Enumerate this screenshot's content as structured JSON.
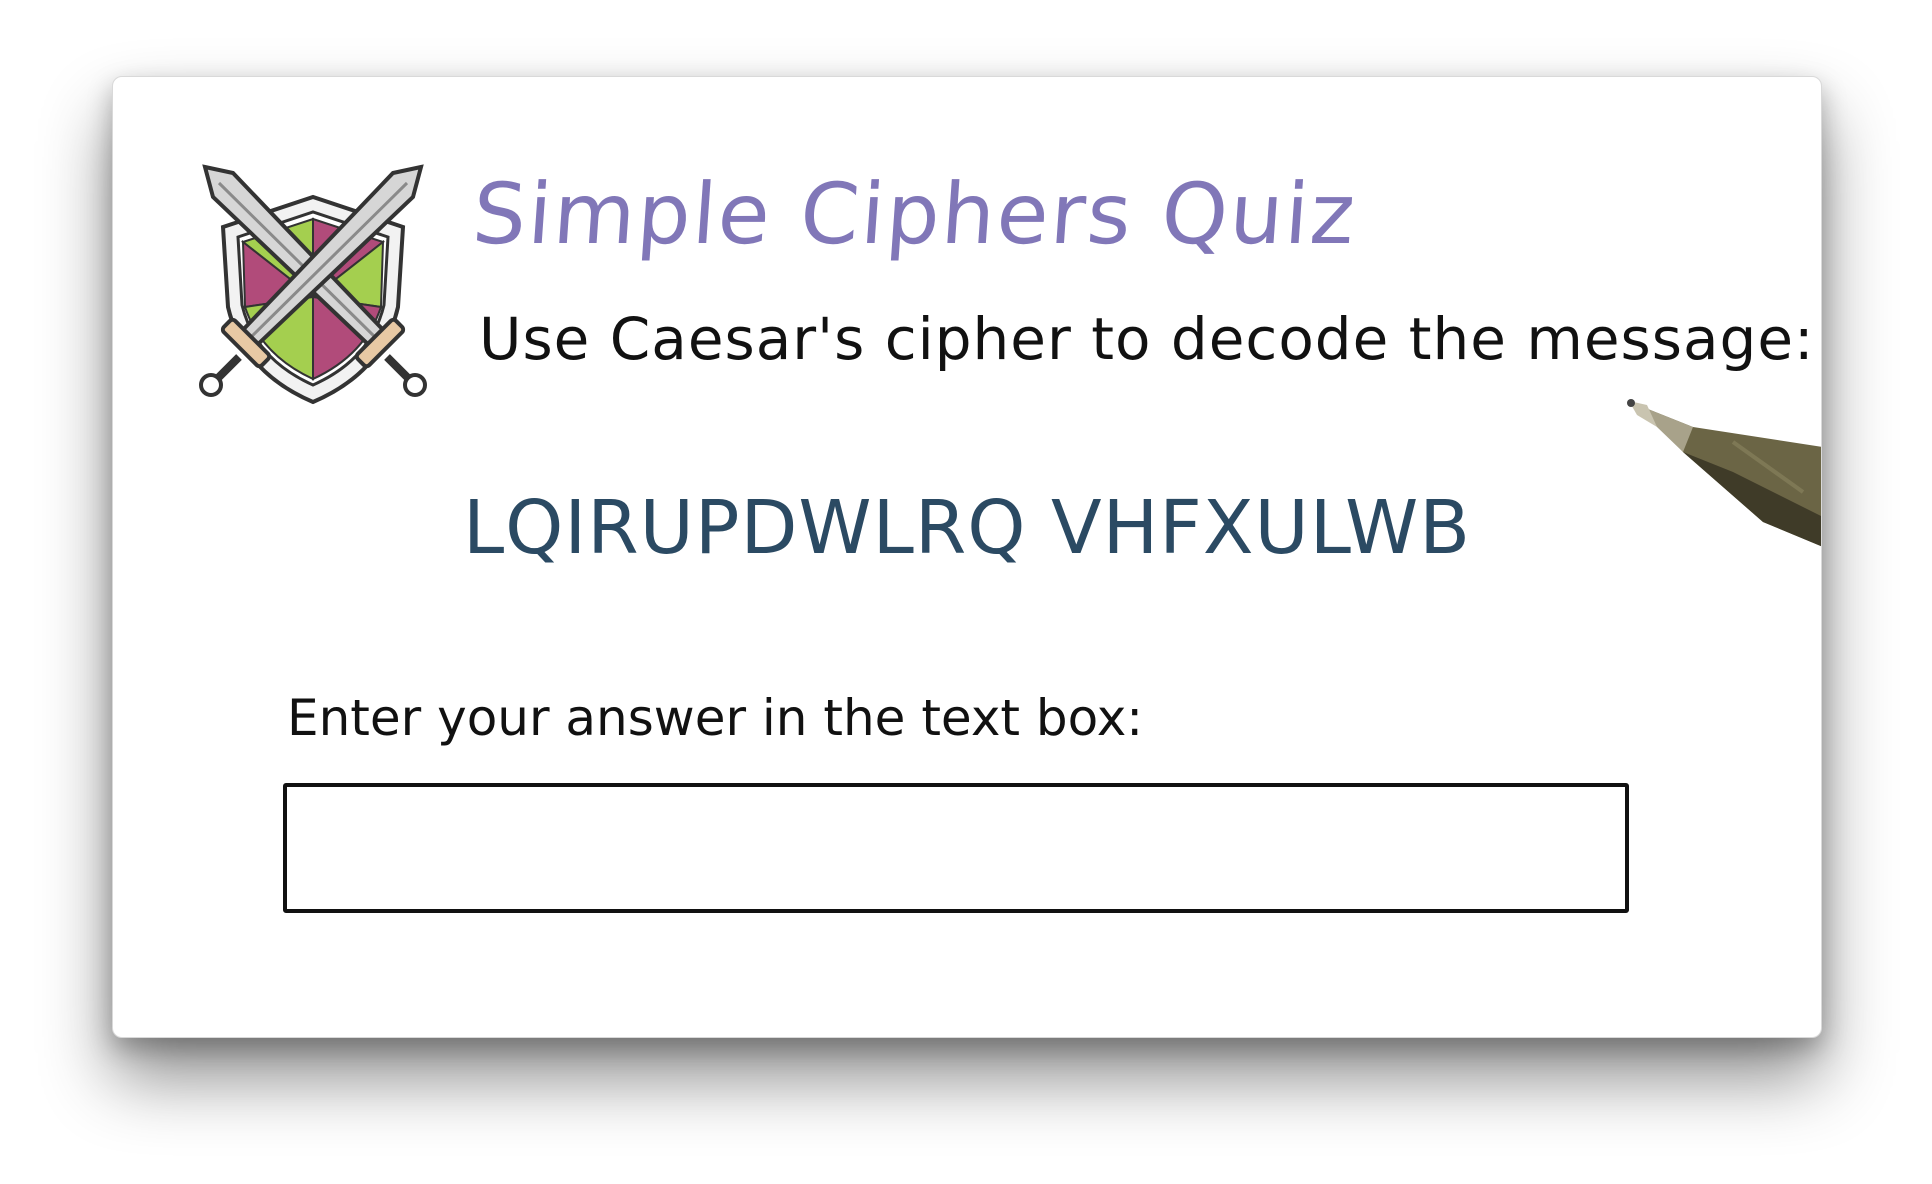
{
  "quiz": {
    "title": "Simple Ciphers Quiz",
    "instruction": "Use Caesar's cipher to decode the message:",
    "ciphertext": "LQIRUPDWLRQ VHFXULWB",
    "prompt": "Enter your answer in the text box:",
    "answer_value": ""
  },
  "icons": {
    "emblem": "crossed-swords-shield-icon",
    "pen": "pen-icon"
  },
  "colors": {
    "title": "#8177b8",
    "ciphertext": "#2b4a63",
    "shield_green": "#a4cf4f",
    "shield_magenta": "#b14b7a",
    "pen_body": "#6b6545"
  }
}
